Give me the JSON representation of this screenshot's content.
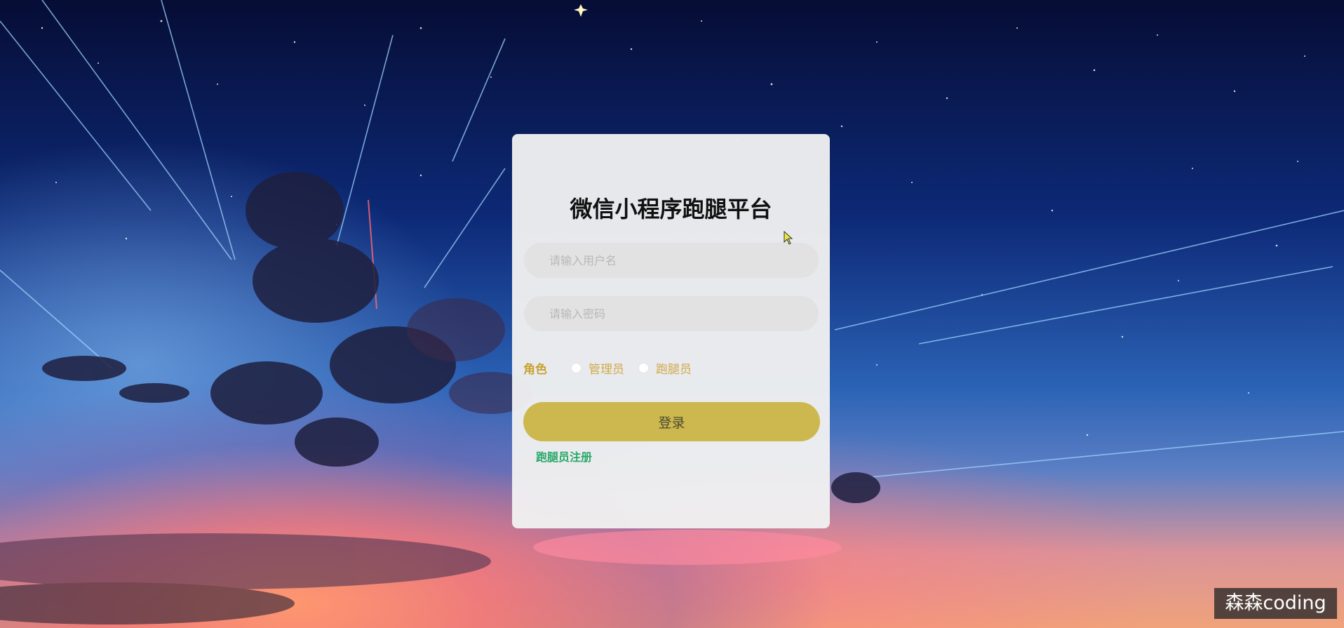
{
  "page": {
    "title": "微信小程序跑腿平台"
  },
  "login_form": {
    "username_placeholder": "请输入用户名",
    "password_placeholder": "请输入密码",
    "role_label": "角色",
    "roles": [
      "管理员",
      "跑腿员"
    ],
    "login_button": "登录",
    "register_link": "跑腿员注册"
  },
  "watermark": {
    "text": "森森coding"
  },
  "colors": {
    "card_bg": "#f0f0f0",
    "login_button": "#cdb84f",
    "role_text": "#d2a94a",
    "register_link": "#2aa86a"
  }
}
